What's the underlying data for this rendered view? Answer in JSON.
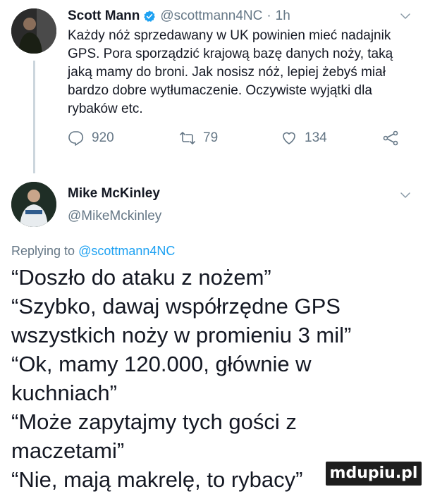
{
  "tweet": {
    "author_name": "Scott Mann",
    "handle": "@scottmann4NC",
    "separator": "·",
    "time": "1h",
    "body": "Każdy nóż sprzedawany w UK powinien mieć nadajnik GPS. Pora sporządzić krajową bazę danych noży, taką jaką mamy do broni. Jak nosisz nóż, lepiej żebyś miał bardzo dobre wytłumaczenie. Oczywiste wyjątki dla rybaków etc.",
    "replies": "920",
    "retweets": "79",
    "likes": "134"
  },
  "reply": {
    "author_name": "Mike McKinley",
    "handle": "@MikeMckinley",
    "replying_prefix": "Replying to",
    "replying_to": "@scottmann4NC",
    "lines": [
      "“Doszło do ataku z nożem”",
      "“Szybko, dawaj współrzędne GPS wszystkich noży w promieniu 3 mil”",
      "“Ok, mamy 120.000, głównie w kuchniach”",
      "“Może zapytajmy tych gości z maczetami”",
      "“Nie, mają makrelę, to rybacy”"
    ]
  },
  "watermark": "mdupiu.pl",
  "colors": {
    "verified": "#1da1f2",
    "secondary_text": "#657786",
    "link": "#1da1f2"
  },
  "icons": {
    "verified": "verified-badge-icon",
    "chevron": "chevron-down-icon",
    "reply": "reply-icon",
    "retweet": "retweet-icon",
    "like": "heart-icon",
    "share": "share-icon"
  }
}
